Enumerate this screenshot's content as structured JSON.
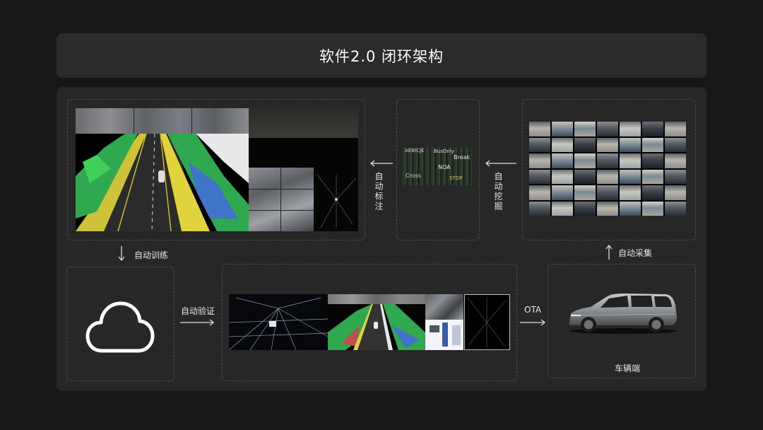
{
  "title": "软件2.0 闭环架构",
  "labels": {
    "auto_annotate": "自动标注",
    "auto_mine": "自动挖掘",
    "auto_train": "自动训练",
    "auto_collect": "自动采集",
    "auto_verify": "自动验证",
    "ota": "OTA",
    "vehicle": "车辆端"
  },
  "annotation_words": [
    "AEBICJE",
    "BusOnly",
    "Break",
    "NOA",
    "Cross",
    "STOP"
  ],
  "colors": {
    "background": "#171717",
    "panel": "#272727",
    "title_bar": "#2b2b2b",
    "dashed_border": "#4d4d4d",
    "green": "#2fa84f",
    "blue": "#3f74c9",
    "yellow": "#e0d33b"
  },
  "icons": {
    "cloud": "cloud-icon",
    "vehicle": "suv-car-icon"
  }
}
